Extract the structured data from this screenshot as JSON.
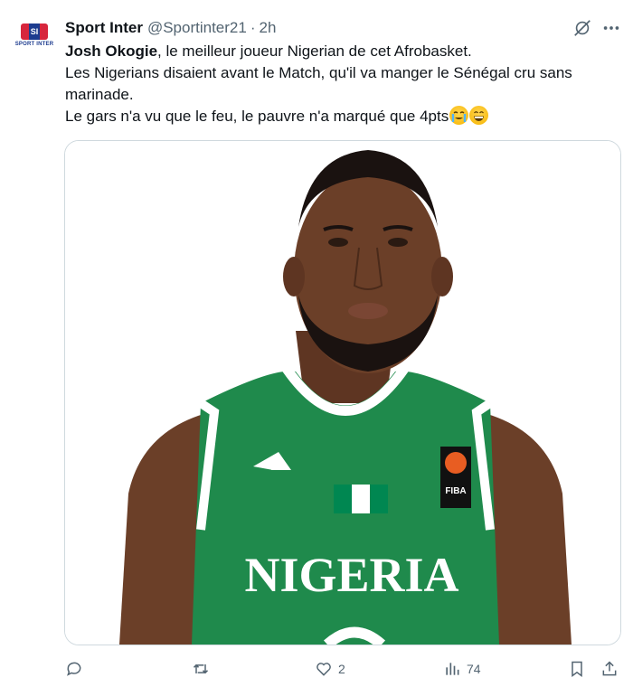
{
  "tweet": {
    "author_name": "Sport Inter",
    "handle": "@Sportinter21",
    "separator": "·",
    "time": "2h",
    "avatar_logo_text": "SPORT INTER",
    "text_bold": "Josh Okogie",
    "text_line1_rest": ", le meilleur joueur Nigerian de cet Afrobasket.",
    "text_line2": "Les Nigerians disaient avant le Match, qu'il va manger le Sénégal cru sans marinade.",
    "text_line3": "Le gars n'a vu que le feu, le pauvre n'a marqué que 4pts",
    "emojis": [
      "loudly-crying-face",
      "grinning-face"
    ]
  },
  "media": {
    "jersey_text": "NIGERIA",
    "badge_text": "FIBA",
    "colors": {
      "jersey": "#1f8a4c",
      "trim": "#ffffff",
      "skin": "#6b3f28"
    }
  },
  "actions": {
    "reply_count": "",
    "retweet_count": "",
    "like_count": "2",
    "views_count": "74"
  },
  "colors": {
    "text": "#0f1419",
    "muted": "#536471",
    "border": "#cfd9de"
  }
}
